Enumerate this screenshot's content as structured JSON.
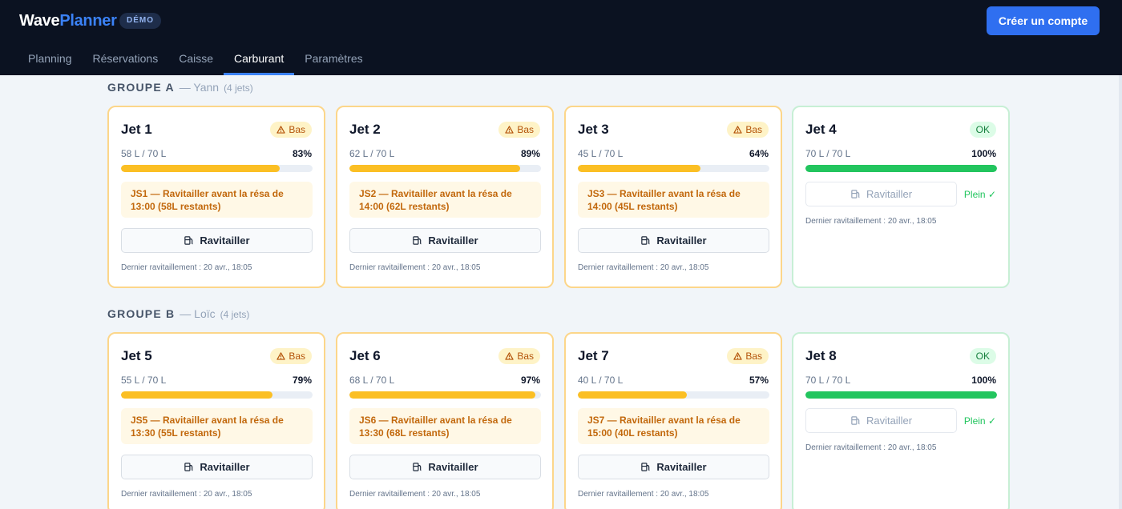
{
  "app": {
    "brand_part1": "Wave",
    "brand_part2": "Planner",
    "badge": "DÉMO",
    "cta_label": "Créer un compte",
    "accent_color": "#3b82f6"
  },
  "nav": {
    "tabs": [
      {
        "label": "Planning",
        "active": false
      },
      {
        "label": "Réservations",
        "active": false
      },
      {
        "label": "Caisse",
        "active": false
      },
      {
        "label": "Carburant",
        "active": true
      },
      {
        "label": "Paramètres",
        "active": false
      }
    ]
  },
  "groups": [
    {
      "name": "GROUPE A",
      "lead": "— Yann",
      "count": "(4 jets)",
      "jets": [
        {
          "title": "Jet 1",
          "status": "Bas",
          "status_kind": "low",
          "level": "58 L / 70 L",
          "percent_label": "83%",
          "fill": 0.83,
          "alert": "JS1 — Ravitailler avant la résa de 13:00 (58L restants)",
          "button": "Ravitailler",
          "full_label": "",
          "last_refuel": "Dernier ravitaillement : 20 avr., 18:05"
        },
        {
          "title": "Jet 2",
          "status": "Bas",
          "status_kind": "low",
          "level": "62 L / 70 L",
          "percent_label": "89%",
          "fill": 0.89,
          "alert": "JS2 — Ravitailler avant la résa de 14:00 (62L restants)",
          "button": "Ravitailler",
          "full_label": "",
          "last_refuel": "Dernier ravitaillement : 20 avr., 18:05"
        },
        {
          "title": "Jet 3",
          "status": "Bas",
          "status_kind": "low",
          "level": "45 L / 70 L",
          "percent_label": "64%",
          "fill": 0.64,
          "alert": "JS3 — Ravitailler avant la résa de 14:00 (45L restants)",
          "button": "Ravitailler",
          "full_label": "",
          "last_refuel": "Dernier ravitaillement : 20 avr., 18:05"
        },
        {
          "title": "Jet 4",
          "status": "OK",
          "status_kind": "good",
          "level": "70 L / 70 L",
          "percent_label": "100%",
          "fill": 1.0,
          "alert": "",
          "button": "Ravitailler",
          "full_label": "Plein ✓",
          "last_refuel": "Dernier ravitaillement : 20 avr., 18:05"
        }
      ]
    },
    {
      "name": "GROUPE B",
      "lead": "— Loïc",
      "count": "(4 jets)",
      "jets": [
        {
          "title": "Jet 5",
          "status": "Bas",
          "status_kind": "low",
          "level": "55 L / 70 L",
          "percent_label": "79%",
          "fill": 0.79,
          "alert": "JS5 — Ravitailler avant la résa de 13:30 (55L restants)",
          "button": "Ravitailler",
          "full_label": "",
          "last_refuel": "Dernier ravitaillement : 20 avr., 18:05"
        },
        {
          "title": "Jet 6",
          "status": "Bas",
          "status_kind": "low",
          "level": "68 L / 70 L",
          "percent_label": "97%",
          "fill": 0.97,
          "alert": "JS6 — Ravitailler avant la résa de 13:30 (68L restants)",
          "button": "Ravitailler",
          "full_label": "",
          "last_refuel": "Dernier ravitaillement : 20 avr., 18:05"
        },
        {
          "title": "Jet 7",
          "status": "Bas",
          "status_kind": "low",
          "level": "40 L / 70 L",
          "percent_label": "57%",
          "fill": 0.57,
          "alert": "JS7 — Ravitailler avant la résa de 15:00 (40L restants)",
          "button": "Ravitailler",
          "full_label": "",
          "last_refuel": "Dernier ravitaillement : 20 avr., 18:05"
        },
        {
          "title": "Jet 8",
          "status": "OK",
          "status_kind": "good",
          "level": "70 L / 70 L",
          "percent_label": "100%",
          "fill": 1.0,
          "alert": "",
          "button": "Ravitailler",
          "full_label": "Plein ✓",
          "last_refuel": "Dernier ravitaillement : 20 avr., 18:05"
        }
      ]
    }
  ],
  "icons": {
    "warning": "warning-triangle-icon",
    "button": "fuel-pump-icon"
  }
}
